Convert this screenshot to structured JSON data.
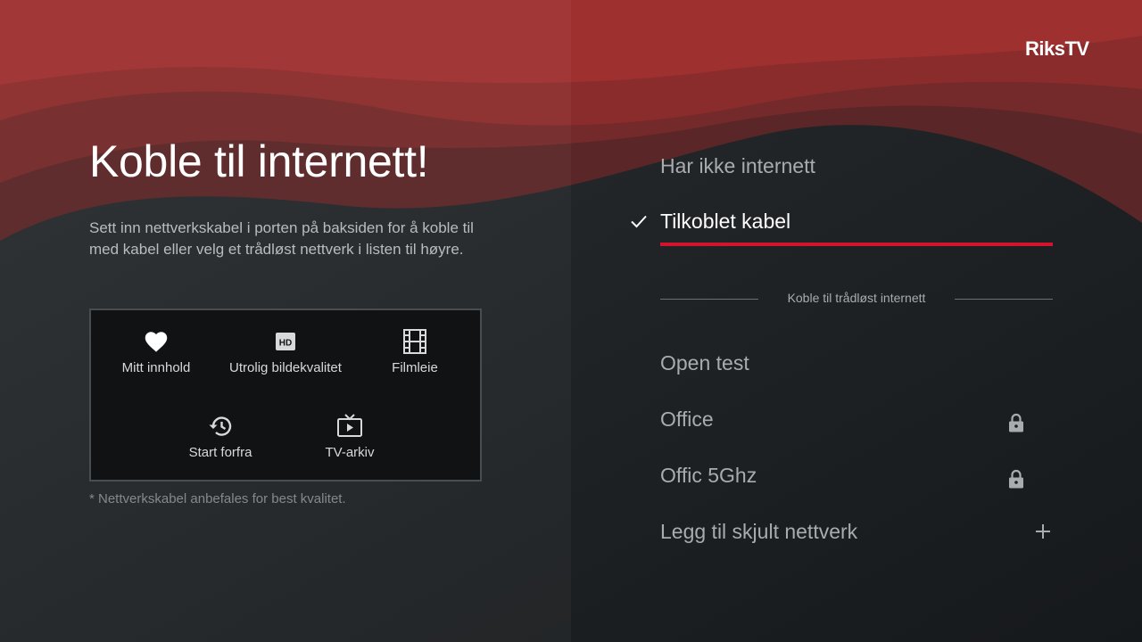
{
  "brand": {
    "logo": "RiksTV"
  },
  "left": {
    "title": "Koble til internett!",
    "description": "Sett inn nettverkskabel i porten på baksiden for å koble til med kabel eller velg et trådløst nettverk i listen til høyre.",
    "features": [
      {
        "icon": "heart-icon",
        "label": "Mitt innhold"
      },
      {
        "icon": "hd-icon",
        "label": "Utrolig bildekvalitet"
      },
      {
        "icon": "film-icon",
        "label": "Filmleie"
      },
      {
        "icon": "restart-icon",
        "label": "Start forfra"
      },
      {
        "icon": "tv-archive-icon",
        "label": "TV-arkiv"
      }
    ],
    "footnote": "* Nettverkskabel anbefales for best kvalitet."
  },
  "right": {
    "options": [
      {
        "label": "Har ikke internett",
        "selected": false
      },
      {
        "label": "Tilkoblet kabel",
        "selected": true
      }
    ],
    "wireless_heading": "Koble til trådløst internett",
    "networks": [
      {
        "name": "Open test",
        "icon": ""
      },
      {
        "name": "Office",
        "icon": "lock-icon"
      },
      {
        "name": "Offic 5Ghz",
        "icon": "lock-icon"
      },
      {
        "name": "Legg til skjult nettverk",
        "icon": "plus-icon"
      }
    ]
  },
  "colors": {
    "accent": "#d3142c",
    "background": "#1b1e21",
    "wave": "#8e2a2a"
  }
}
